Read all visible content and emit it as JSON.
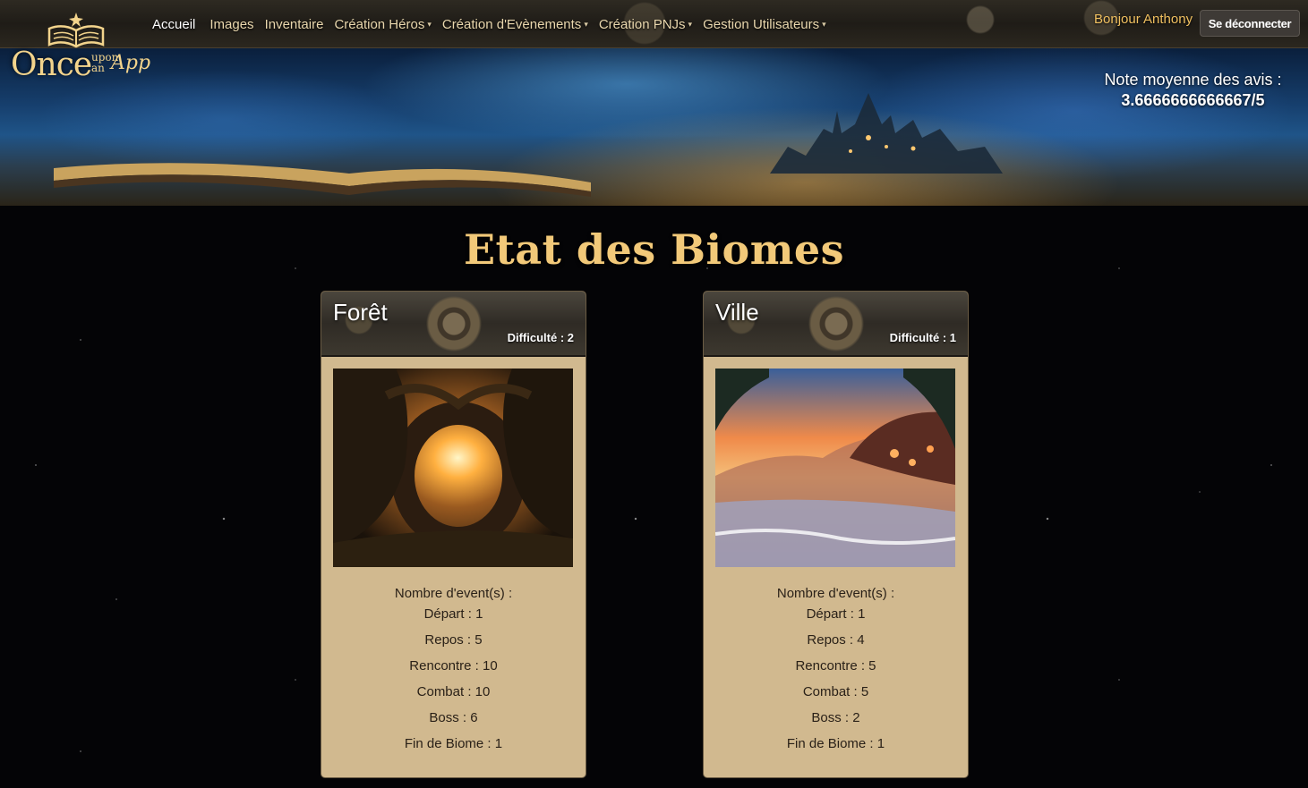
{
  "app": {
    "logo_main": "nce",
    "logo_initial": "O",
    "logo_upon": "upon",
    "logo_an": "an",
    "logo_app": "App"
  },
  "nav": {
    "items": [
      {
        "label": "Accueil",
        "dropdown": false,
        "active": true
      },
      {
        "label": "Images",
        "dropdown": false
      },
      {
        "label": "Inventaire",
        "dropdown": false
      },
      {
        "label": "Création Héros",
        "dropdown": true
      },
      {
        "label": "Création d'Evènements",
        "dropdown": true
      },
      {
        "label": "Création PNJs",
        "dropdown": true
      },
      {
        "label": "Gestion Utilisateurs",
        "dropdown": true
      }
    ],
    "greeting": "Bonjour Anthony",
    "logout": "Se déconnecter"
  },
  "banner": {
    "rating_label": "Note moyenne des avis :",
    "rating_value": "3.6666666666667/5"
  },
  "page": {
    "title": "Etat des Biomes"
  },
  "biomes": [
    {
      "name": "Forêt",
      "difficulty": "Difficulté : 2",
      "image_icon": "forest-tree-sunlight-image",
      "events_label": "Nombre d'event(s) :",
      "depart": "Départ : 1",
      "repos": "Repos : 5",
      "rencontre": "Rencontre : 10",
      "combat": "Combat : 10",
      "boss": "Boss : 6",
      "fin": "Fin de Biome : 1"
    },
    {
      "name": "Ville",
      "difficulty": "Difficulté : 1",
      "image_icon": "sunset-beach-image",
      "events_label": "Nombre d'event(s) :",
      "depart": "Départ : 1",
      "repos": "Repos : 4",
      "rencontre": "Rencontre : 5",
      "combat": "Combat : 5",
      "boss": "Boss : 2",
      "fin": "Fin de Biome : 1"
    }
  ],
  "colors": {
    "accent_gold": "#f2c979",
    "card_bg": "#d1b98f",
    "greeting": "#f0c060"
  }
}
